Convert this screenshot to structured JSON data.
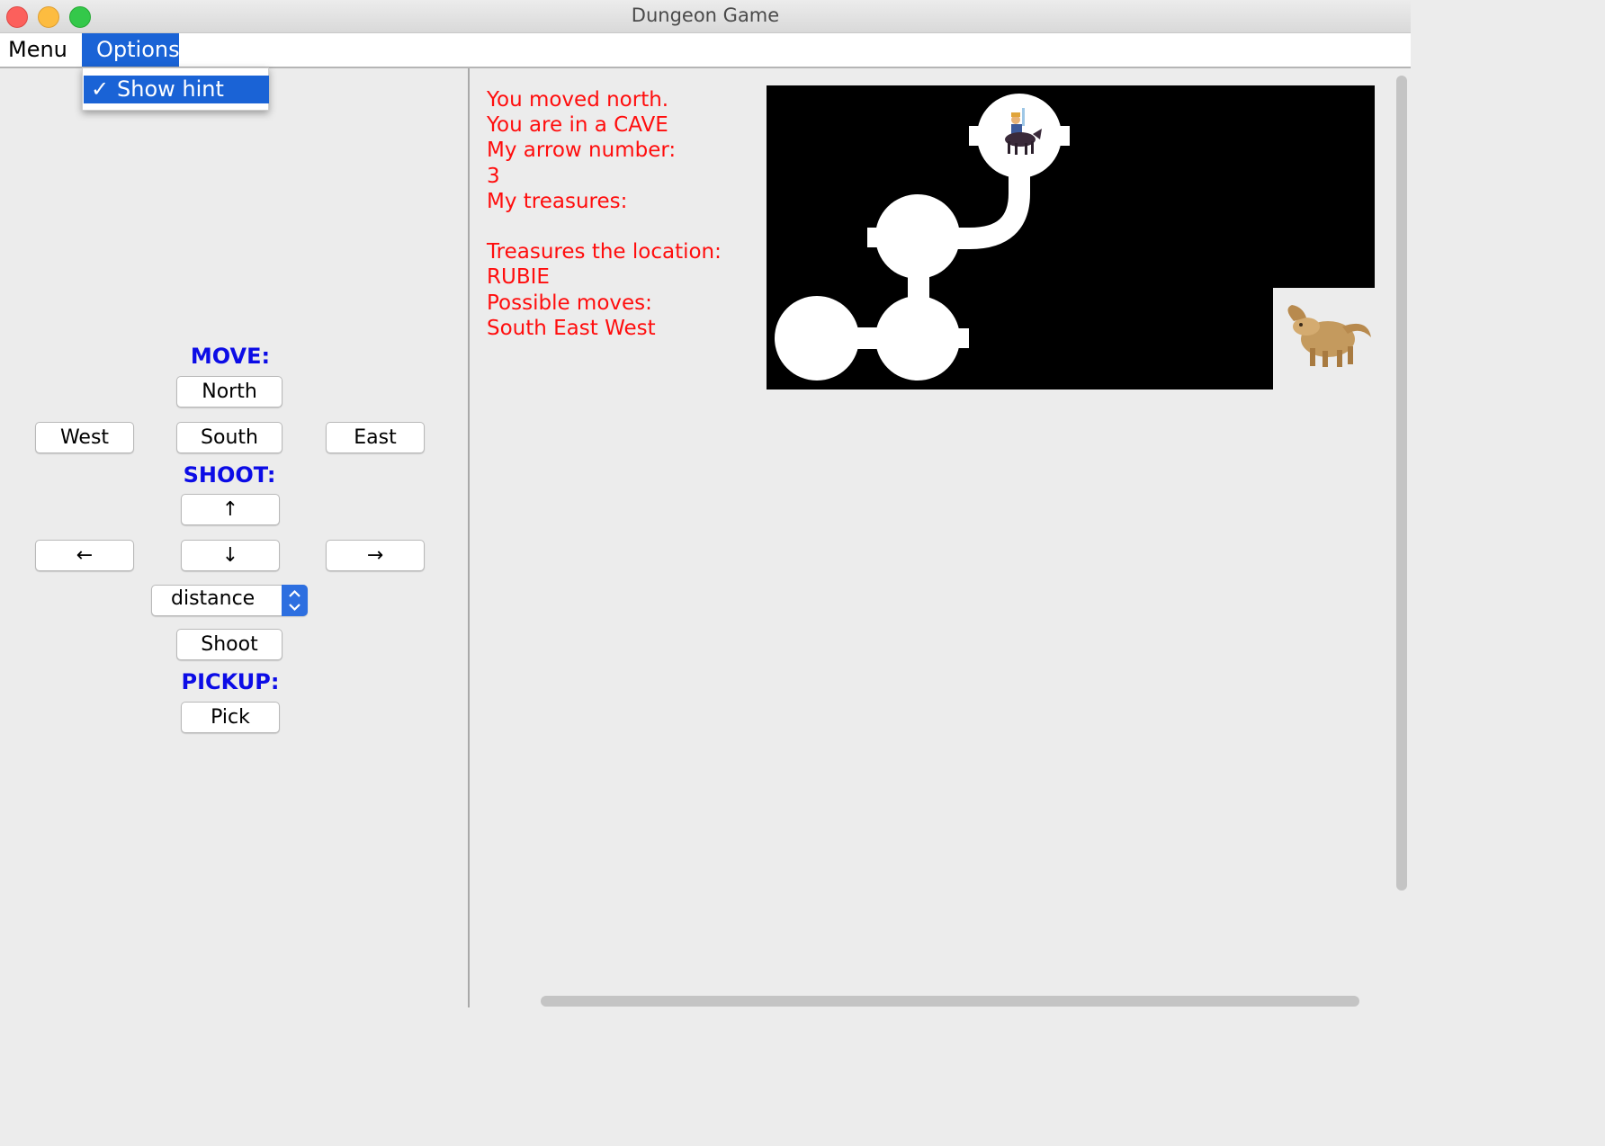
{
  "window": {
    "title": "Dungeon Game"
  },
  "menubar": {
    "menu": "Menu",
    "options": "Options"
  },
  "options_menu": {
    "show_hint": "Show hint",
    "checkmark": "✓"
  },
  "controls": {
    "move_label": "MOVE:",
    "north": "North",
    "west": "West",
    "south": "South",
    "east": "East",
    "shoot_label": "SHOOT:",
    "arrow_up": "↑",
    "arrow_left": "←",
    "arrow_down": "↓",
    "arrow_right": "→",
    "distance_select": "distance",
    "shoot": "Shoot",
    "pickup_label": "PICKUP:",
    "pick": "Pick"
  },
  "info": {
    "lines": [
      "You moved north.",
      "You are in a CAVE",
      "My arrow number:",
      "3",
      "My treasures:",
      "",
      "Treasures the location:",
      "RUBIE",
      "Possible moves:",
      "South East West"
    ]
  },
  "colors": {
    "info_text": "#ff0d0d",
    "section_label": "#0c0ce6",
    "menu_highlight": "#1a63d6",
    "map_background": "#000000",
    "map_path": "#ffffff"
  },
  "map": {
    "player_icon": "knight-on-horse-icon",
    "monster_icon": "otyugh-monster-icon"
  }
}
